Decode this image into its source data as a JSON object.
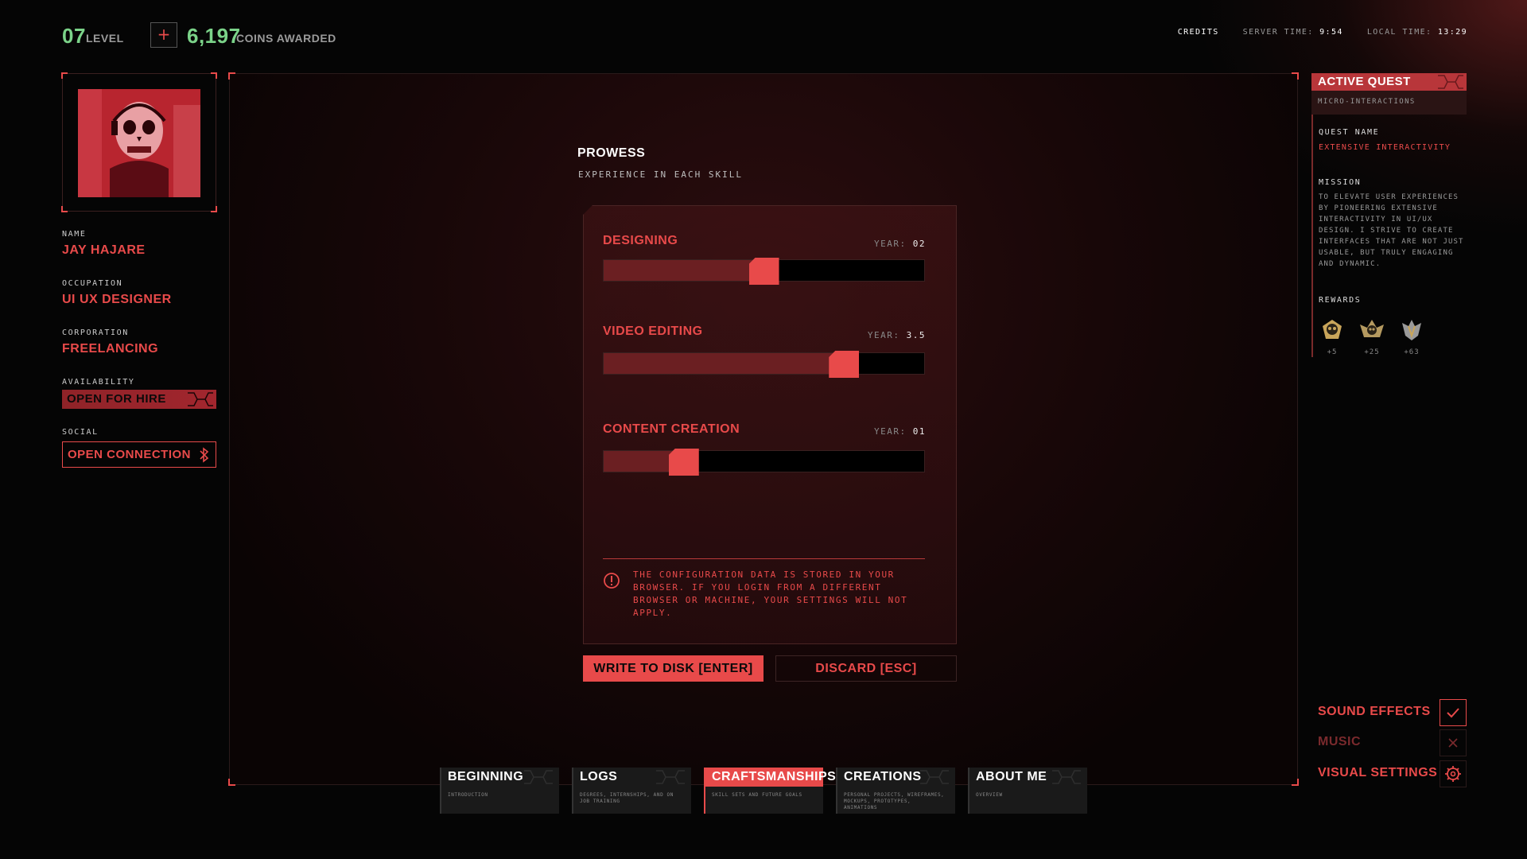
{
  "top": {
    "level_value": "07",
    "level_label": "LEVEL",
    "add_button": "+",
    "coins_value": "6,197",
    "coins_label": "COINS AWARDED",
    "credits": "CREDITS",
    "server_time_label": "SERVER TIME:",
    "server_time": "9:54",
    "local_time_label": "LOCAL TIME:",
    "local_time": "13:29"
  },
  "profile": {
    "name_label": "NAME",
    "name": "JAY HAJARE",
    "occupation_label": "OCCUPATION",
    "occupation": "UI UX DESIGNER",
    "corporation_label": "CORPORATION",
    "corporation": "FREELANCING",
    "availability_label": "AVAILABILITY",
    "availability": "OPEN FOR HIRE",
    "social_label": "SOCIAL",
    "social_button": "OPEN CONNECTION"
  },
  "prowess": {
    "title": "PROWESS",
    "subtitle": "EXPERIENCE IN EACH SKILL",
    "year_label": "YEAR:",
    "skills": [
      {
        "name": "DESIGNING",
        "year": "02",
        "level": 0.5
      },
      {
        "name": "VIDEO EDITING",
        "year": "3.5",
        "level": 0.75
      },
      {
        "name": "CONTENT CREATION",
        "year": "01",
        "level": 0.25
      }
    ],
    "warning": "THE CONFIGURATION DATA IS STORED IN YOUR BROWSER. IF YOU LOGIN FROM A DIFFERENT BROWSER OR MACHINE, YOUR SETTINGS WILL NOT APPLY.",
    "write_button": "WRITE TO DISK [ENTER]",
    "discard_button": "DISCARD [ESC]"
  },
  "nav": [
    {
      "title": "BEGINNING",
      "desc": "INTRODUCTION"
    },
    {
      "title": "LOGS",
      "desc": "DEGREES, INTERNSHIPS, AND ON JOB TRAINING"
    },
    {
      "title": "CRAFTSMANSHIPS",
      "desc": "SKILL SETS AND FUTURE GOALS"
    },
    {
      "title": "CREATIONS",
      "desc": "PERSONAL PROJECTS, WIREFRAMES, MOCKUPS, PROTOTYPES, ANIMATIONS"
    },
    {
      "title": "ABOUT ME",
      "desc": "OVERVIEW"
    }
  ],
  "quest": {
    "header": "ACTIVE QUEST",
    "category": "MICRO-INTERACTIONS",
    "name_label": "QUEST NAME",
    "name": "EXTENSIVE INTERACTIVITY",
    "mission_label": "MISSION",
    "mission": "TO ELEVATE USER EXPERIENCES BY PIONEERING EXTENSIVE INTERACTIVITY IN UI/UX DESIGN. I STRIVE TO CREATE INTERFACES THAT ARE NOT JUST USABLE, BUT TRULY ENGAGING AND DYNAMIC.",
    "rewards_label": "REWARDS",
    "rewards": [
      "+5",
      "+25",
      "+63"
    ]
  },
  "settings": {
    "sound_effects": "SOUND EFFECTS",
    "music": "MUSIC",
    "visual_settings": "VISUAL SETTINGS"
  },
  "colors": {
    "accent": "#e84a4a",
    "level_green": "#7bd389",
    "background": "#050505"
  }
}
